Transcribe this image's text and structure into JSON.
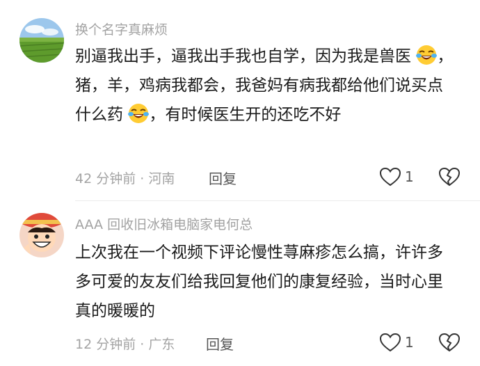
{
  "comments": [
    {
      "username": "换个名字真麻烦",
      "text_parts": [
        "别逼我出手，逼我出手我也自学，因为我是兽医",
        "，猪，羊，鸡病我都会，我爸妈有病我都给他们说买点什么药",
        "，有时候医生开的还吃不好"
      ],
      "emoji": "grinning-tears-emoji",
      "time_location": "42 分钟前 · 河南",
      "reply_label": "回复",
      "like_count": "1",
      "avatar": "rice-field-avatar"
    },
    {
      "username": "AAA 回收旧冰箱电脑家电何总",
      "text": "上次我在一个视频下评论慢性荨麻疹怎么搞，许许多多可爱的友友们给我回复他们的康复经验，当时心里真的暖暖的",
      "time_location": "12 分钟前 · 广东",
      "reply_label": "回复",
      "like_count": "1",
      "avatar": "cartoon-character-avatar"
    }
  ]
}
